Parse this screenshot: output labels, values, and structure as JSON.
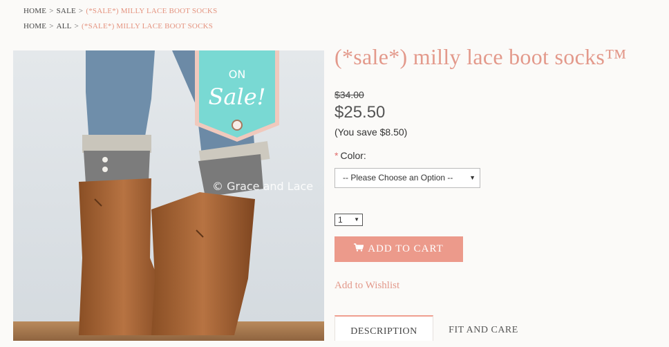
{
  "breadcrumbs": [
    {
      "items": [
        "HOME",
        "SALE"
      ],
      "current": "(*SALE*) MILLY LACE BOOT SOCKS"
    },
    {
      "items": [
        "HOME",
        "ALL"
      ],
      "current": "(*SALE*) MILLY LACE BOOT SOCKS"
    }
  ],
  "separator": ">",
  "image": {
    "tag_line1": "ON",
    "tag_line2": "Sale!",
    "watermark": "© Grace and Lace"
  },
  "product": {
    "title": "(*sale*) milly lace boot socks™",
    "old_price": "$34.00",
    "price": "$25.50",
    "savings": "(You save $8.50)",
    "required_mark": "*",
    "color_label": "Color:",
    "color_select_value": "-- Please Choose an Option --",
    "quantity_value": "1",
    "add_to_cart": "ADD TO CART",
    "wishlist": "Add to Wishlist"
  },
  "tabs": [
    {
      "label": "DESCRIPTION",
      "active": true
    },
    {
      "label": "FIT AND CARE",
      "active": false
    }
  ],
  "colors": {
    "accent": "#e3998b",
    "button": "#ec9a8b",
    "tag": "#79d9d3"
  }
}
